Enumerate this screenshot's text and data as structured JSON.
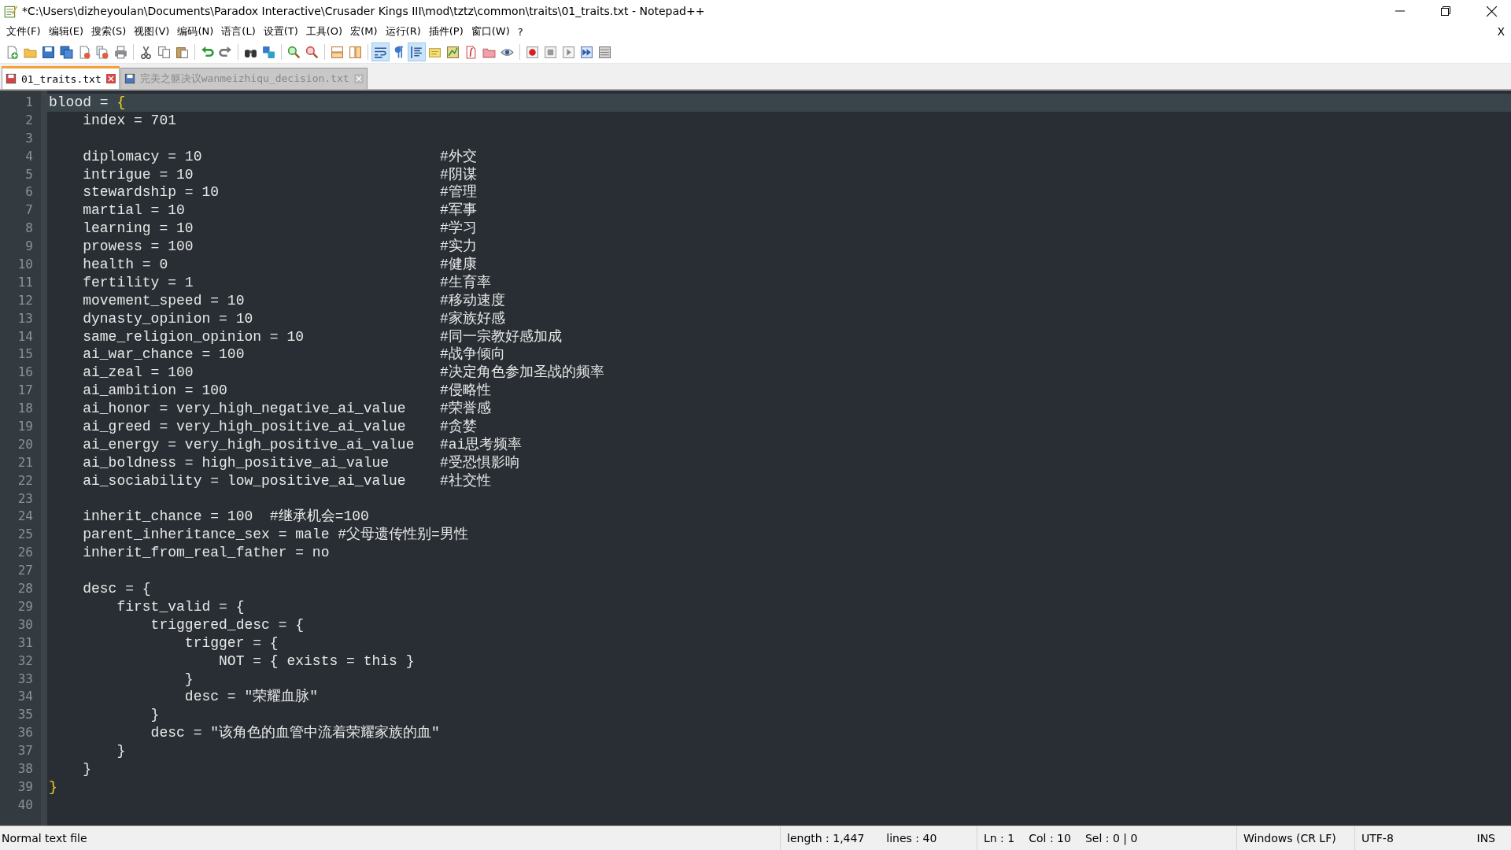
{
  "window": {
    "title": "*C:\\Users\\dizheyoulan\\Documents\\Paradox Interactive\\Crusader Kings III\\mod\\tztz\\common\\traits\\01_traits.txt - Notepad++"
  },
  "menu": [
    "文件(F)",
    "编辑(E)",
    "搜索(S)",
    "视图(V)",
    "编码(N)",
    "语言(L)",
    "设置(T)",
    "工具(O)",
    "宏(M)",
    "运行(R)",
    "插件(P)",
    "窗口(W)",
    "?"
  ],
  "close_document": "X",
  "toolbar": [
    {
      "kind": "new",
      "pressed": false
    },
    {
      "kind": "open",
      "pressed": false
    },
    {
      "kind": "save",
      "pressed": false
    },
    {
      "kind": "saveall",
      "pressed": false
    },
    {
      "kind": "close",
      "pressed": false
    },
    {
      "kind": "closeall",
      "pressed": false
    },
    {
      "kind": "print",
      "pressed": false
    },
    {
      "kind": "separator"
    },
    {
      "kind": "cut",
      "pressed": false
    },
    {
      "kind": "copy",
      "pressed": false
    },
    {
      "kind": "paste",
      "pressed": false
    },
    {
      "kind": "separator"
    },
    {
      "kind": "undo",
      "pressed": false
    },
    {
      "kind": "redo",
      "pressed": false
    },
    {
      "kind": "separator"
    },
    {
      "kind": "find",
      "pressed": false
    },
    {
      "kind": "replace",
      "pressed": false
    },
    {
      "kind": "separator"
    },
    {
      "kind": "zoomin",
      "pressed": false
    },
    {
      "kind": "zoomout",
      "pressed": false
    },
    {
      "kind": "separator"
    },
    {
      "kind": "syncv",
      "pressed": false
    },
    {
      "kind": "synch",
      "pressed": false
    },
    {
      "kind": "separator"
    },
    {
      "kind": "wrap",
      "pressed": true
    },
    {
      "kind": "allchars",
      "pressed": false
    },
    {
      "kind": "indent",
      "pressed": true
    },
    {
      "kind": "udl",
      "pressed": false
    },
    {
      "kind": "docmap",
      "pressed": false
    },
    {
      "kind": "funclist",
      "pressed": false
    },
    {
      "kind": "folder",
      "pressed": false
    },
    {
      "kind": "monitor",
      "pressed": false
    },
    {
      "kind": "separator"
    },
    {
      "kind": "record",
      "pressed": false
    },
    {
      "kind": "stop",
      "pressed": false
    },
    {
      "kind": "play",
      "pressed": false
    },
    {
      "kind": "playmulti",
      "pressed": false
    },
    {
      "kind": "savemacro",
      "pressed": false
    }
  ],
  "tabs": [
    {
      "label": "01_traits.txt",
      "selected": true,
      "modified": true
    },
    {
      "label": "完美之躯决议wanmeizhiqu_decision.txt",
      "selected": false,
      "modified": false
    }
  ],
  "editor": {
    "lines": [
      {
        "number": "1",
        "code": "blood = ",
        "matched_brace": "{",
        "current": true
      },
      {
        "number": "2",
        "code": "    index = 701",
        "current": false
      },
      {
        "number": "3",
        "current": false
      },
      {
        "number": "4",
        "code": "    diplomacy = 10",
        "comment": "#外交",
        "current": false
      },
      {
        "number": "5",
        "code": "    intrigue = 10",
        "comment": "#阴谋",
        "current": false
      },
      {
        "number": "6",
        "code": "    stewardship = 10",
        "comment": "#管理",
        "current": false
      },
      {
        "number": "7",
        "code": "    martial = 10",
        "comment": "#军事",
        "current": false
      },
      {
        "number": "8",
        "code": "    learning = 10",
        "comment": "#学习",
        "current": false
      },
      {
        "number": "9",
        "code": "    prowess = 100",
        "comment": "#实力",
        "current": false
      },
      {
        "number": "10",
        "code": "    health = 0",
        "comment": "#健康",
        "current": false
      },
      {
        "number": "11",
        "code": "    fertility = 1",
        "comment": "#生育率",
        "current": false
      },
      {
        "number": "12",
        "code": "    movement_speed = 10",
        "comment": "#移动速度",
        "current": false
      },
      {
        "number": "13",
        "code": "    dynasty_opinion = 10",
        "comment": "#家族好感",
        "current": false
      },
      {
        "number": "14",
        "code": "    same_religion_opinion = 10",
        "comment": "#同一宗教好感加成",
        "current": false
      },
      {
        "number": "15",
        "code": "    ai_war_chance = 100",
        "comment": "#战争倾向",
        "current": false
      },
      {
        "number": "16",
        "code": "    ai_zeal = 100",
        "comment": "#决定角色参加圣战的频率",
        "current": false
      },
      {
        "number": "17",
        "code": "    ai_ambition = 100",
        "comment": "#侵略性",
        "current": false
      },
      {
        "number": "18",
        "code": "    ai_honor = very_high_negative_ai_value",
        "comment": "#荣誉感",
        "current": false
      },
      {
        "number": "19",
        "code": "    ai_greed = very_high_positive_ai_value",
        "comment": "#贪婪",
        "current": false
      },
      {
        "number": "20",
        "code": "    ai_energy = very_high_positive_ai_value",
        "comment": "#ai思考频率",
        "current": false
      },
      {
        "number": "21",
        "code": "    ai_boldness = high_positive_ai_value",
        "comment": "#受恐惧影响",
        "current": false
      },
      {
        "number": "22",
        "code": "    ai_sociability = low_positive_ai_value",
        "comment": "#社交性",
        "current": false
      },
      {
        "number": "23",
        "current": false
      },
      {
        "number": "24",
        "code": "    inherit_chance = 100  #继承机会=100",
        "current": false
      },
      {
        "number": "25",
        "code": "    parent_inheritance_sex = male #父母遗传性别=男性",
        "current": false
      },
      {
        "number": "26",
        "code": "    inherit_from_real_father = no",
        "current": false
      },
      {
        "number": "27",
        "current": false
      },
      {
        "number": "28",
        "code": "    desc = {",
        "current": false
      },
      {
        "number": "29",
        "code": "        first_valid = {",
        "current": false
      },
      {
        "number": "30",
        "code": "            triggered_desc = {",
        "current": false
      },
      {
        "number": "31",
        "code": "                trigger = {",
        "current": false
      },
      {
        "number": "32",
        "code": "                    NOT = { exists = this }",
        "current": false
      },
      {
        "number": "33",
        "code": "                }",
        "current": false
      },
      {
        "number": "34",
        "code": "                desc = \"荣耀血脉\"",
        "current": false
      },
      {
        "number": "35",
        "code": "            }",
        "current": false
      },
      {
        "number": "36",
        "code": "            desc = \"该角色的血管中流着荣耀家族的血\"",
        "current": false
      },
      {
        "number": "37",
        "code": "        }",
        "current": false
      },
      {
        "number": "38",
        "code": "    }",
        "current": false
      },
      {
        "number": "39",
        "matched_brace": "}",
        "current": false
      },
      {
        "number": "40",
        "current": false
      }
    ]
  },
  "status_bar": {
    "file_type": "Normal text file",
    "length": "length : 1,447",
    "lines": "lines : 40",
    "line": "Ln : 1",
    "column": "Col : 10",
    "selection": "Sel : 0 | 0",
    "eol": "Windows (CR LF)",
    "encoding": "UTF-8",
    "mode": "INS"
  }
}
